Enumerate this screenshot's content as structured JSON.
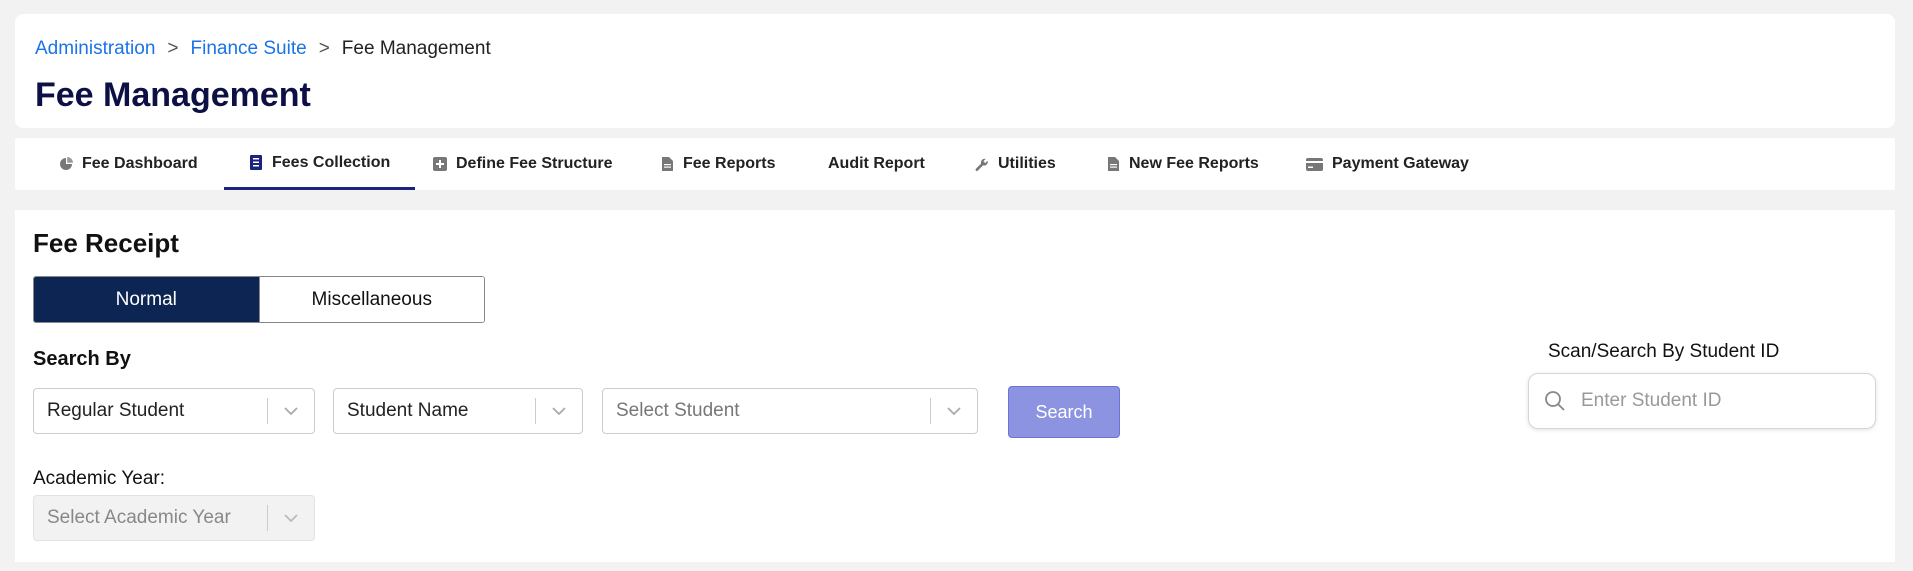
{
  "breadcrumb": {
    "items": [
      "Administration",
      "Finance Suite"
    ],
    "current": "Fee Management",
    "separator": ">"
  },
  "page_title": "Fee Management",
  "tabs": [
    {
      "label": "Fee Dashboard",
      "icon": "pie-chart-icon"
    },
    {
      "label": "Fees Collection",
      "icon": "receipt-icon",
      "active": true
    },
    {
      "label": "Define Fee Structure",
      "icon": "plus-square-icon"
    },
    {
      "label": "Fee Reports",
      "icon": "document-icon"
    },
    {
      "label": "Audit Report",
      "icon": ""
    },
    {
      "label": "Utilities",
      "icon": "wrench-icon"
    },
    {
      "label": "New Fee Reports",
      "icon": "document-icon"
    },
    {
      "label": "Payment Gateway",
      "icon": "credit-card-icon"
    }
  ],
  "fee_receipt": {
    "title": "Fee Receipt",
    "mode_options": [
      "Normal",
      "Miscellaneous"
    ],
    "selected_mode": "Normal",
    "search_by_label": "Search By",
    "student_type": "Regular Student",
    "search_field": "Student Name",
    "student_placeholder": "Select Student",
    "search_button": "Search",
    "academic_year_label": "Academic Year:",
    "academic_year_placeholder": "Select Academic Year",
    "scan_label": "Scan/Search By Student ID",
    "student_id_placeholder": "Enter Student ID"
  },
  "colors": {
    "accent": "#1a237e",
    "link": "#1a73e8",
    "title": "#0d1045",
    "toggle_active": "#0d2552",
    "search_button": "#8c93e0"
  }
}
